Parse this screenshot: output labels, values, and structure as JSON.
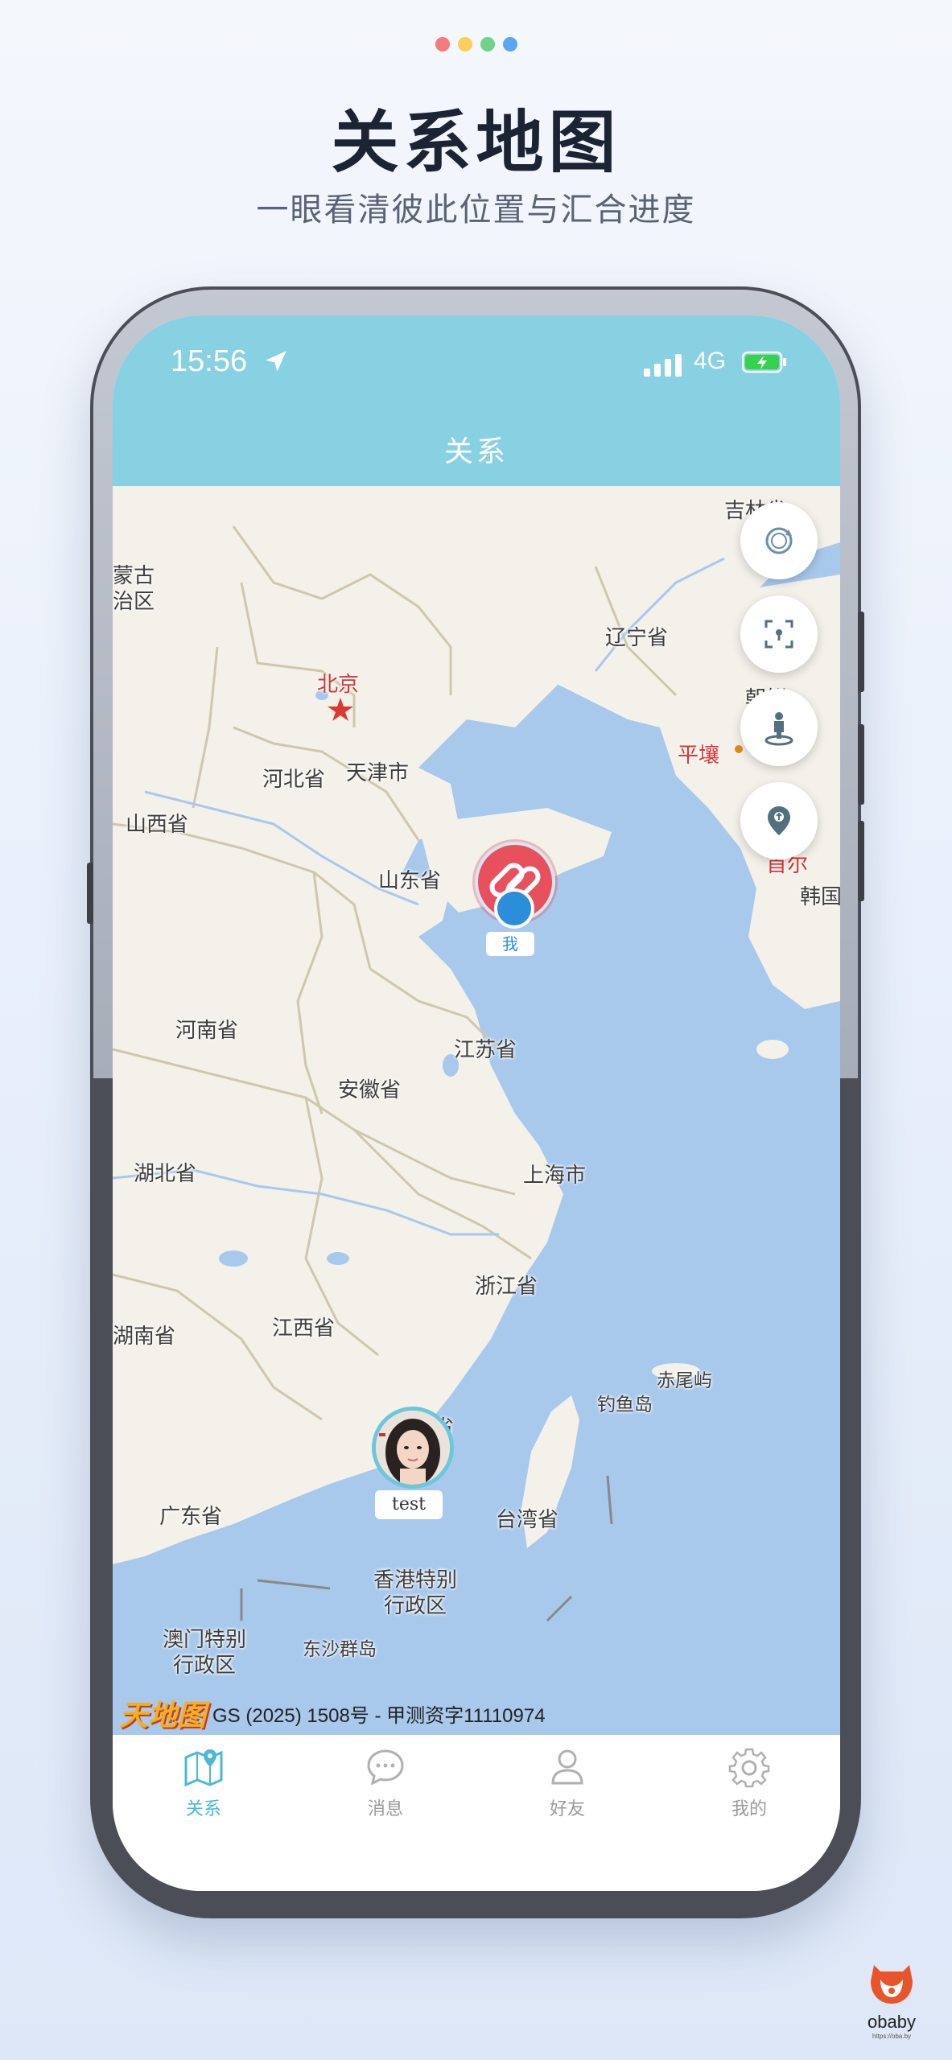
{
  "promo": {
    "title": "关系地图",
    "subtitle": "一眼看清彼此位置与汇合进度",
    "dot_colors": [
      "#f47b7b",
      "#f7cf5a",
      "#6fd28a",
      "#5aa6f2"
    ]
  },
  "status_bar": {
    "time": "15:56",
    "network": "4G",
    "battery_color": "#35d24b"
  },
  "header": {
    "title": "关系"
  },
  "map": {
    "labels": {
      "jilin": "吉林省",
      "menggu": "蒙古\n治区",
      "liaoning": "辽宁省",
      "chaoxian": "朝鲜",
      "pingrang": "平壤",
      "shouer": "首尔",
      "hanguo": "韩国",
      "beijing": "北京",
      "tianjin": "天津市",
      "hebei": "河北省",
      "shanxi": "山西省",
      "shandong": "山东省",
      "henan": "河南省",
      "jiangsu": "江苏省",
      "anhui": "安徽省",
      "hubei": "湖北省",
      "shanghai": "上海市",
      "zhejiang": "浙江省",
      "jiangxi": "江西省",
      "hunan": "湖南省",
      "fujian": "省",
      "chiweiyu": "赤尾屿",
      "diaoyudao": "钓鱼岛",
      "taiwan": "台湾省",
      "guangdong": "广东省",
      "hongkong": "香港特别\n行政区",
      "macau": "澳门特别\n行政区",
      "dongsha": "东沙群岛"
    },
    "attribution_logo": "天地图",
    "attribution": "GS (2025) 1508号 - 甲测资字11110974",
    "markers": {
      "me_label": "我",
      "friend_label": "test"
    },
    "controls": [
      "refresh-icon",
      "focus-frame-icon",
      "person-pin-icon",
      "location-pin-icon"
    ]
  },
  "tabs": [
    {
      "label": "关系",
      "icon": "map-pin-icon",
      "active": true
    },
    {
      "label": "消息",
      "icon": "chat-bubble-icon",
      "active": false
    },
    {
      "label": "好友",
      "icon": "person-icon",
      "active": false
    },
    {
      "label": "我的",
      "icon": "gear-icon",
      "active": false
    }
  ],
  "brand": {
    "name": "obaby",
    "url": "https://oba.by"
  },
  "colors": {
    "accent": "#87d1e3",
    "tab_active": "#4bb8d6",
    "me_marker": "#e7505c",
    "sea": "#a8c8ec",
    "land": "#f3f1ea"
  }
}
